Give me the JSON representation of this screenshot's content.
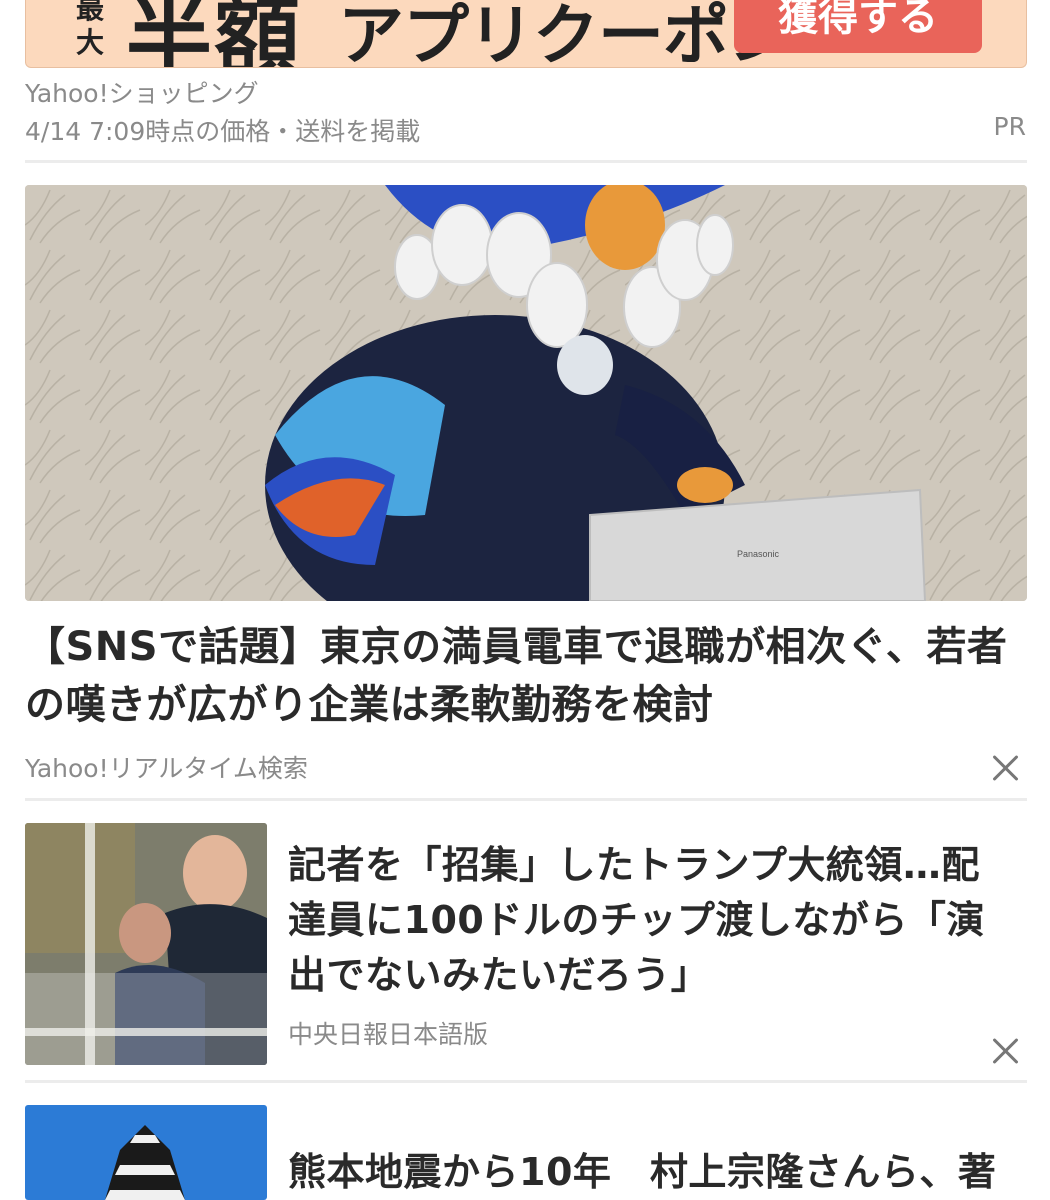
{
  "ad": {
    "stack_top": "最",
    "stack_bottom": "大",
    "big_text": "半額",
    "sub_text": "アプリクーポン",
    "cta_label": "獲得する"
  },
  "shopping": {
    "source": "Yahoo!ショッピング",
    "price_note": "4/14 7:09時点の価格・送料を掲載",
    "pr_label": "PR"
  },
  "hero": {
    "image_label": "Panasonic",
    "title": "【SNSで話題】東京の満員電車で退職が相次ぐ、若者の嘆きが広がり企業は柔軟勤務を検討",
    "source": "Yahoo!リアルタイム検索"
  },
  "articles": [
    {
      "title": "記者を「招集」したトランプ大統領…配達員に100ドルのチップ渡しながら「演出でないみたいだろう」",
      "source": "中央日報日本語版"
    },
    {
      "title": "熊本地震から10年　村上宗隆さんら、著"
    }
  ],
  "colors": {
    "ad_background": "#fcd9bd",
    "ad_cta": "#e9645a",
    "meta_text": "#8a8a8a"
  },
  "icons": {
    "dismiss": "close-icon"
  }
}
